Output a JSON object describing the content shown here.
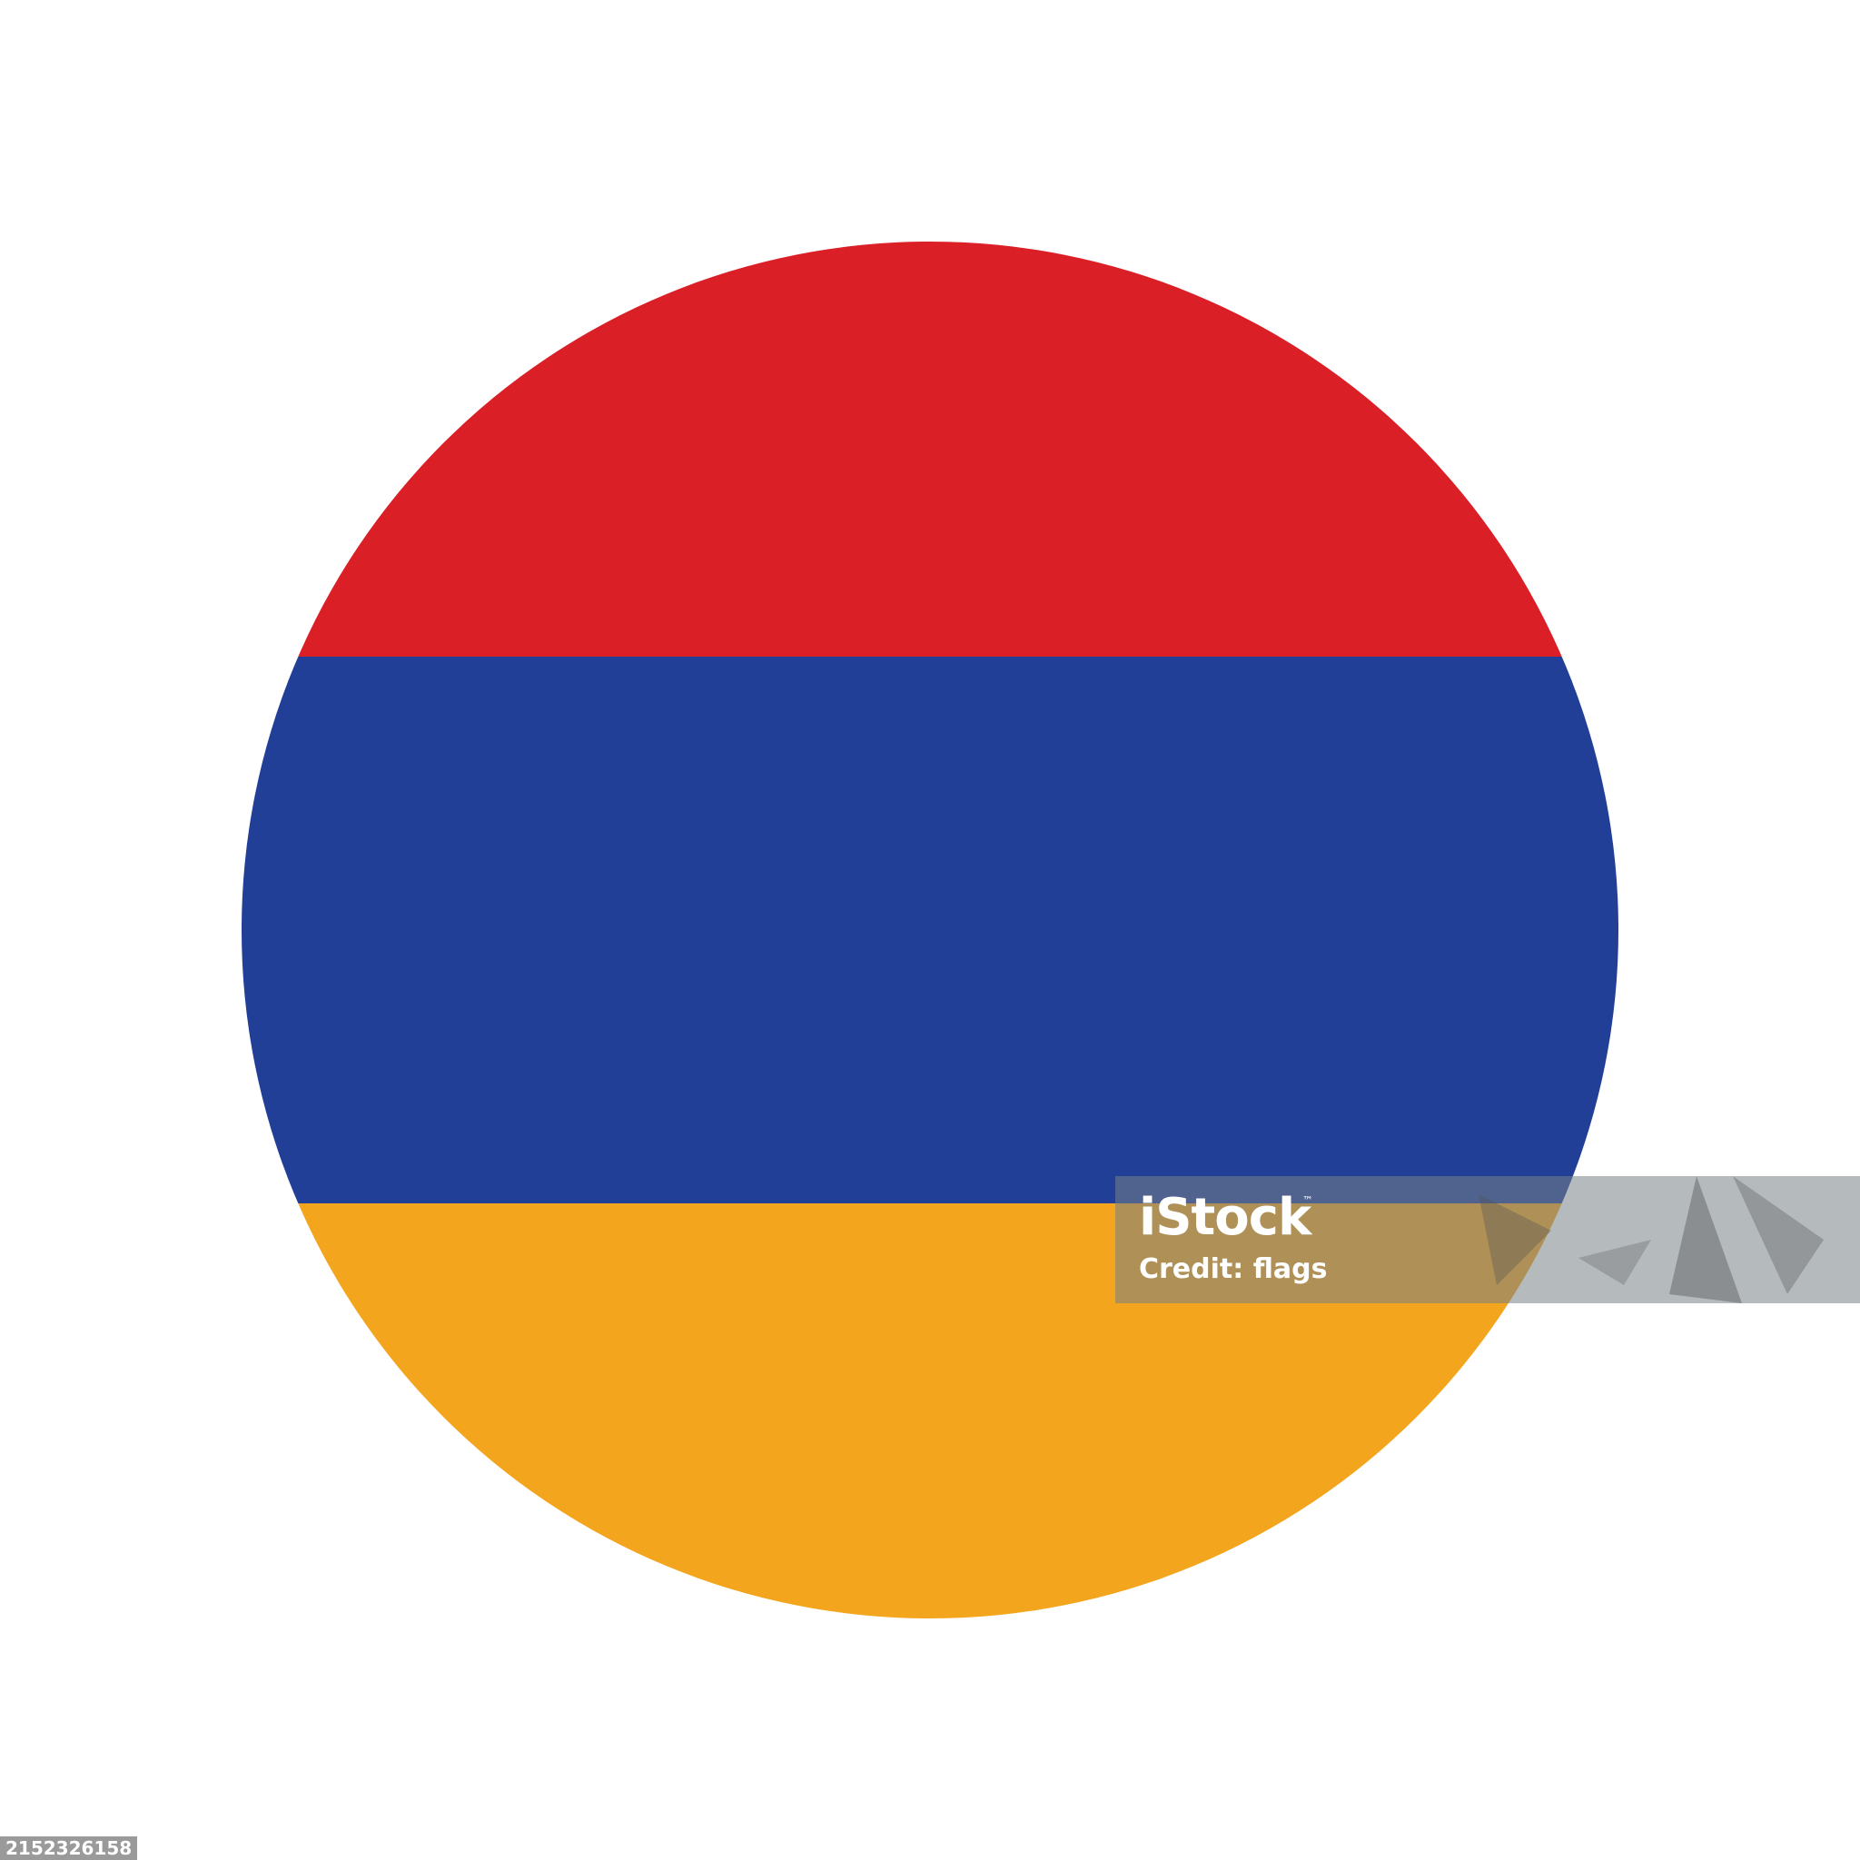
{
  "flag": {
    "stripes": [
      {
        "name": "red",
        "color": "#DA1F27"
      },
      {
        "name": "blue",
        "color": "#213F97"
      },
      {
        "name": "orange",
        "color": "#F2A51D"
      }
    ]
  },
  "watermark": {
    "logo": "iStock",
    "trademark": "™",
    "credit": "Credit: flags"
  },
  "image_id": "2152326158"
}
